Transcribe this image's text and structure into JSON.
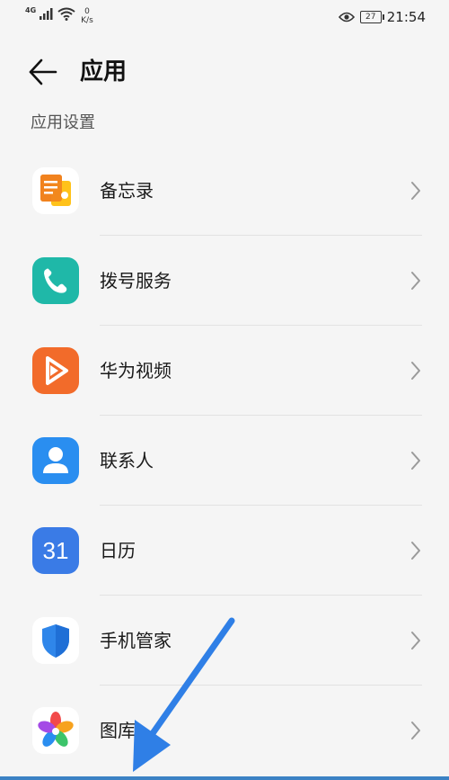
{
  "status": {
    "signal_label": "4G",
    "speed_value": "0",
    "speed_unit": "K/s",
    "battery": "27",
    "time": "21:54"
  },
  "header": {
    "title": "应用"
  },
  "section": {
    "title": "应用设置"
  },
  "apps": [
    {
      "label": "备忘录",
      "icon": "notepad-icon"
    },
    {
      "label": "拨号服务",
      "icon": "phone-icon"
    },
    {
      "label": "华为视频",
      "icon": "video-play-icon"
    },
    {
      "label": "联系人",
      "icon": "contact-icon"
    },
    {
      "label": "日历",
      "icon": "calendar-icon",
      "icon_text": "31"
    },
    {
      "label": "手机管家",
      "icon": "shield-icon"
    },
    {
      "label": "图库",
      "icon": "gallery-flower-icon"
    }
  ],
  "colors": {
    "accent_arrow": "#2f7fe6",
    "phone_teal": "#1fb8a8",
    "video_orange": "#f26b2a",
    "contact_blue": "#2a8ef0",
    "calendar_blue": "#3a7be6",
    "shield_blue": "#2f86ea"
  }
}
